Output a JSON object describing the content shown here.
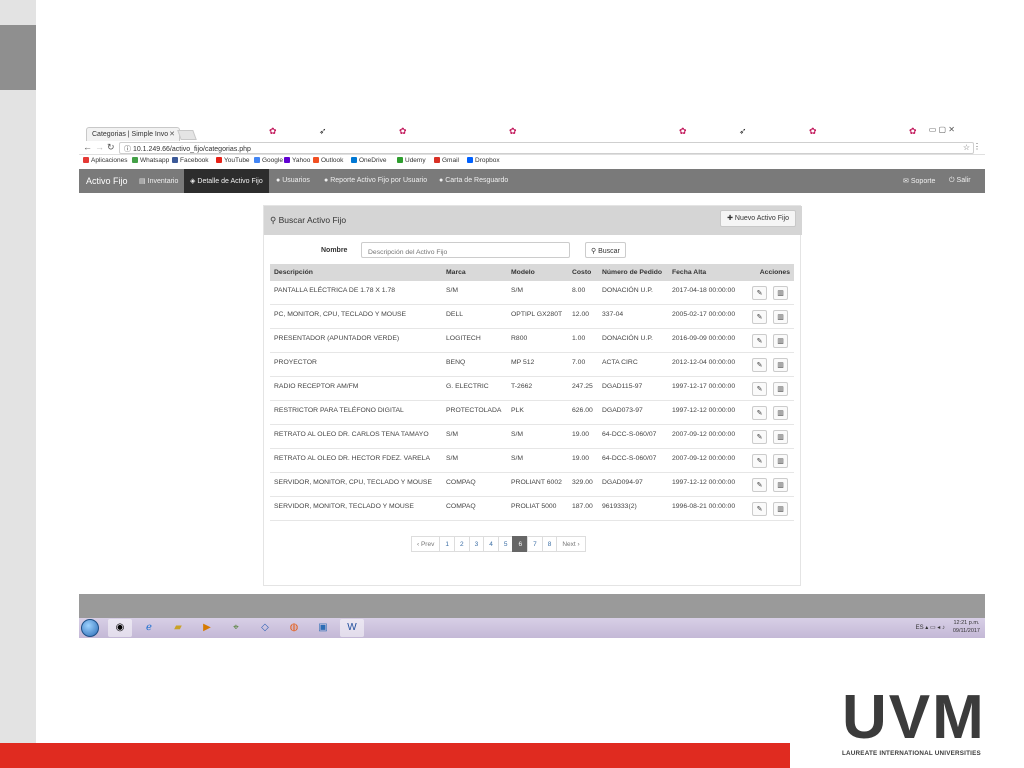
{
  "browser": {
    "tab_title": "Categorias | Simple Invo",
    "tab_close": "✕",
    "url": "10.1.249.66/activo_fijo/categorias.php",
    "bookmarks": [
      {
        "label": "Aplicaciones",
        "color": "#e53935"
      },
      {
        "label": "Whatsapp",
        "color": "#43a047"
      },
      {
        "label": "Facebook",
        "color": "#3b5998"
      },
      {
        "label": "YouTube",
        "color": "#e62117"
      },
      {
        "label": "Google",
        "color": "#4285f4"
      },
      {
        "label": "Yahoo",
        "color": "#6001d2"
      },
      {
        "label": "Outlook",
        "color": "#f25022"
      },
      {
        "label": "OneDrive",
        "color": "#0078d4"
      },
      {
        "label": "Udemy",
        "color": "#2e9e2e"
      },
      {
        "label": "Gmail",
        "color": "#d93025"
      },
      {
        "label": "Dropbox",
        "color": "#0061ff"
      }
    ]
  },
  "navbar": {
    "brand": "Activo Fijo",
    "items": [
      {
        "label": "Inventario",
        "icon": "list-icon",
        "glyph": "▤",
        "active": false
      },
      {
        "label": "Detalle de Activo Fijo",
        "icon": "tag-icon",
        "glyph": "◈",
        "active": true
      },
      {
        "label": "Usuarios",
        "icon": "user-icon",
        "glyph": "●",
        "active": false
      },
      {
        "label": "Reporte Activo Fijo por Usuario",
        "icon": "user-icon",
        "glyph": "●",
        "active": false
      },
      {
        "label": "Carta de Resguardo",
        "icon": "user-icon",
        "glyph": "●",
        "active": false
      }
    ],
    "right": [
      {
        "label": "Soporte",
        "icon": "envelope-icon",
        "glyph": "✉"
      },
      {
        "label": "Salir",
        "icon": "power-icon",
        "glyph": "⏻"
      }
    ]
  },
  "panel": {
    "title": "Buscar Activo Fijo",
    "new_button": "Nuevo Activo Fijo",
    "search_label": "Nombre",
    "search_placeholder": "Descripción del Activo Fijo",
    "search_button": "Buscar"
  },
  "table": {
    "headers": [
      "Descripción",
      "Marca",
      "Modelo",
      "Costo",
      "Número de Pedido",
      "Fecha Alta",
      "Acciones"
    ],
    "rows": [
      [
        "PANTALLA ELÉCTRICA DE 1.78 X 1.78",
        "S/M",
        "S/M",
        "8.00",
        "DONACIÓN U.P.",
        "2017-04-18 00:00:00"
      ],
      [
        "PC, MONITOR, CPU, TECLADO Y MOUSE",
        "DELL",
        "OPTIPL GX280T",
        "12.00",
        "337-04",
        "2005-02-17 00:00:00"
      ],
      [
        "PRESENTADOR (APUNTADOR VERDE)",
        "LOGITECH",
        "R800",
        "1.00",
        "DONACIÓN U.P.",
        "2016-09-09 00:00:00"
      ],
      [
        "PROYECTOR",
        "BENQ",
        "MP 512",
        "7.00",
        "ACTA CIRC",
        "2012-12-04 00:00:00"
      ],
      [
        "RADIO RECEPTOR AM/FM",
        "G. ELECTRIC",
        "T-2662",
        "247.25",
        "DGAD115-97",
        "1997-12-17 00:00:00"
      ],
      [
        "RESTRICTOR PARA TELÉFONO DIGITAL",
        "PROTECTOLADA",
        "PLK",
        "626.00",
        "DGAD073-97",
        "1997-12-12 00:00:00"
      ],
      [
        "RETRATO AL OLEO DR. CARLOS TENA TAMAYO",
        "S/M",
        "S/M",
        "19.00",
        "64-DCC-S-060/07",
        "2007-09-12 00:00:00"
      ],
      [
        "RETRATO AL OLEO DR. HECTOR FDEZ. VARELA",
        "S/M",
        "S/M",
        "19.00",
        "64-DCC-S-060/07",
        "2007-09-12 00:00:00"
      ],
      [
        "SERVIDOR, MONITOR, CPU, TECLADO Y MOUSE",
        "COMPAQ",
        "PROLIANT 6002",
        "329.00",
        "DGAD094-97",
        "1997-12-12 00:00:00"
      ],
      [
        "SERVIDOR, MONITOR, TECLADO Y MOUSE",
        "COMPAQ",
        "PROLIAT 5000",
        "187.00",
        "9619333(2)",
        "1996-08-21 00:00:00"
      ]
    ]
  },
  "pagination": {
    "prev": "‹ Prev",
    "pages": [
      "1",
      "2",
      "3",
      "4",
      "5",
      "6",
      "7",
      "8"
    ],
    "active": "6",
    "next": "Next ›"
  },
  "taskbar": {
    "language": "ES",
    "time": "12:21 p.m.",
    "date": "09/11/2017"
  },
  "logo": {
    "letters": "UVM",
    "tagline": "LAUREATE INTERNATIONAL UNIVERSITIES"
  },
  "colors": {
    "accent_red": "#e02b20",
    "navbar_gray": "#7a7a7a",
    "active_nav": "#2d2d2d"
  }
}
